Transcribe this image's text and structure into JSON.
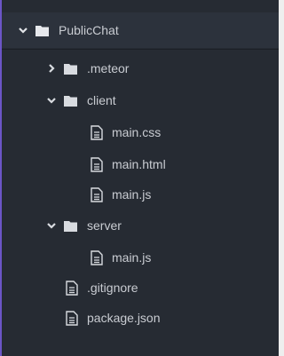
{
  "colors": {
    "panel_bg": "#262b33",
    "selected_bg": "#2c323c",
    "accent": "#6b55c6",
    "text": "#c9ccd2",
    "icon": "#d8dbe0"
  },
  "tree": {
    "root": {
      "label": "PublicChat",
      "icon": "folder-icon",
      "expanded": true
    },
    "meteor": {
      "label": ".meteor",
      "icon": "folder-icon",
      "expanded": false
    },
    "client": {
      "label": "client",
      "icon": "folder-icon",
      "expanded": true
    },
    "client_css": {
      "label": "main.css",
      "icon": "file-icon"
    },
    "client_html": {
      "label": "main.html",
      "icon": "file-icon"
    },
    "client_js": {
      "label": "main.js",
      "icon": "file-icon"
    },
    "server": {
      "label": "server",
      "icon": "folder-icon",
      "expanded": true
    },
    "server_js": {
      "label": "main.js",
      "icon": "file-icon"
    },
    "gitignore": {
      "label": ".gitignore",
      "icon": "file-icon"
    },
    "package": {
      "label": "package.json",
      "icon": "file-icon"
    }
  }
}
